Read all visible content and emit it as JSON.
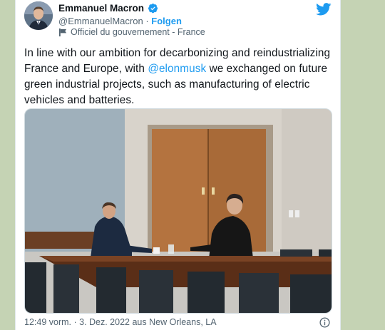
{
  "user": {
    "display_name": "Emmanuel Macron",
    "handle": "@EmmanuelMacron",
    "separator": "·",
    "follow_label": "Folgen",
    "gov_label": "Officiel du gouvernement - France"
  },
  "tweet": {
    "text_before": "In line with our ambition for decarbonizing and reindustrializing France and Europe, with ",
    "mention": "@elonmusk",
    "text_after": " we exchanged on future green industrial projects, such as manufacturing of electric vehicles and batteries."
  },
  "meta": {
    "timestamp": "12:49 vorm. · 3. Dez. 2022 aus New Orleans, LA"
  },
  "icons": {
    "verified": "verified-badge-icon",
    "bird": "twitter-bird-icon",
    "gov": "government-flag-icon",
    "info": "info-icon"
  },
  "colors": {
    "accent": "#1d9bf0",
    "text": "#0f1419",
    "muted": "#536471",
    "page_bg": "#c5d3b4"
  }
}
